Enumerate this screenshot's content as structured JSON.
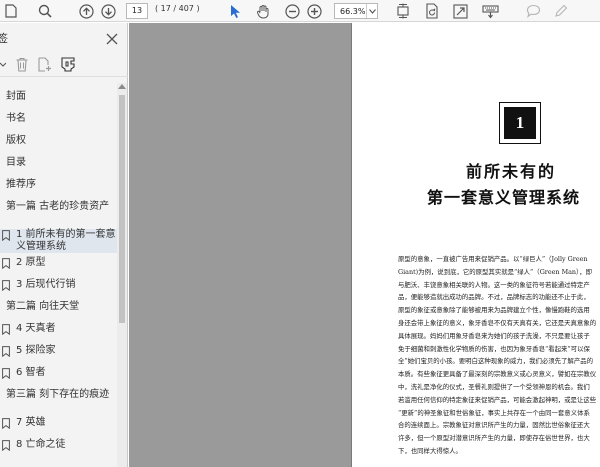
{
  "toolbar": {
    "page_current": "13",
    "page_count": "( 17 / 407 )",
    "zoom": "66.3%",
    "icons": [
      "search-icon",
      "prev-page-icon",
      "next-page-icon",
      "select-cursor-icon",
      "hand-tool-icon",
      "zoom-out-icon",
      "zoom-in-icon",
      "fit-page-icon",
      "rotate-icon",
      "fullscreen-icon",
      "typewriter-icon",
      "comment-icon",
      "pen-icon"
    ]
  },
  "panel": {
    "title": "签",
    "icons": [
      "close-icon",
      "expand-options-icon",
      "delete-bookmark-icon",
      "add-bookmark-icon",
      "bookmark-properties-icon",
      "bookmark-icon"
    ]
  },
  "bookmarks": [
    {
      "label": "封面",
      "icon": false,
      "selected": false
    },
    {
      "label": "书名",
      "icon": false,
      "selected": false
    },
    {
      "label": "版权",
      "icon": false,
      "selected": false
    },
    {
      "label": "目录",
      "icon": false,
      "selected": false
    },
    {
      "label": "推荐序",
      "icon": false,
      "selected": false
    },
    {
      "label": "第一篇 古老的珍贵资产",
      "icon": false,
      "selected": false
    },
    {
      "label": "1 前所未有的第一套意义管理系统",
      "icon": true,
      "selected": true
    },
    {
      "label": "2 原型",
      "icon": true,
      "selected": false
    },
    {
      "label": "3 后现代行销",
      "icon": true,
      "selected": false
    },
    {
      "label": "第二篇 向往天堂",
      "icon": false,
      "selected": false
    },
    {
      "label": "4 天真者",
      "icon": true,
      "selected": false
    },
    {
      "label": "5 探险家",
      "icon": true,
      "selected": false
    },
    {
      "label": "6 智者",
      "icon": true,
      "selected": false
    },
    {
      "label": "第三篇 刻下存在的痕迹",
      "icon": false,
      "selected": false
    },
    {
      "label": "7 英雄",
      "icon": true,
      "selected": false
    },
    {
      "label": "8 亡命之徒",
      "icon": true,
      "selected": false
    }
  ],
  "document": {
    "chapter_number": "1",
    "title_line1": "前所未有的",
    "title_line2": "第一套意义管理系统",
    "paragraph_lines": [
      "原型的意象，一直被广告用来促销产品。以“绿巨人”（Jolly Green",
      "Giant)为例，说到底，它的原型其实就是“绿人”（Green Man），即",
      "与肥沃、丰饶意象相关联的人物。这一类的象征符号若能通过特定产",
      "品，便能够造就出成功的品牌。不过，品牌标志的功能还不止于此，",
      "原型的象征或意象除了能够被用来为品牌建立个性，像慢跑鞋的选用",
      "身还会带上象征的意义，象牙香皂不仅有天真有关，它还是天真意象的",
      "具体展现。妈妈们用象牙香皂来为她们的孩子洗澡，不只是要让孩子",
      "免于细菌和刺激性化学物质的伤害，也因为象牙香皂“看起来”可以保",
      "全”她们宝贝的小孩。要明白这种现象的威力，我们必须先了解产品的",
      "本质。有些象征更具备了最深刻的宗教意义或心灵意义，譬如在宗教仪",
      "中，洗礼是净化的仪式，圣餐礼则提供了一个受领神恩的机会。我们",
      "若滥用任何信仰的特定象征来促销产品，可能会激起神明，或是让这些",
      "“更新”的神圣象征和世俗象征，事实上共存在一个由同一套意义体系",
      "合的连续面上。宗教象征对意识所产生的力量，固然比世俗象征还大",
      "许多，但一个原型对潜意识所产生的力量，即使存在俗世世界，也大",
      "下，也同样大得惊人。"
    ]
  }
}
